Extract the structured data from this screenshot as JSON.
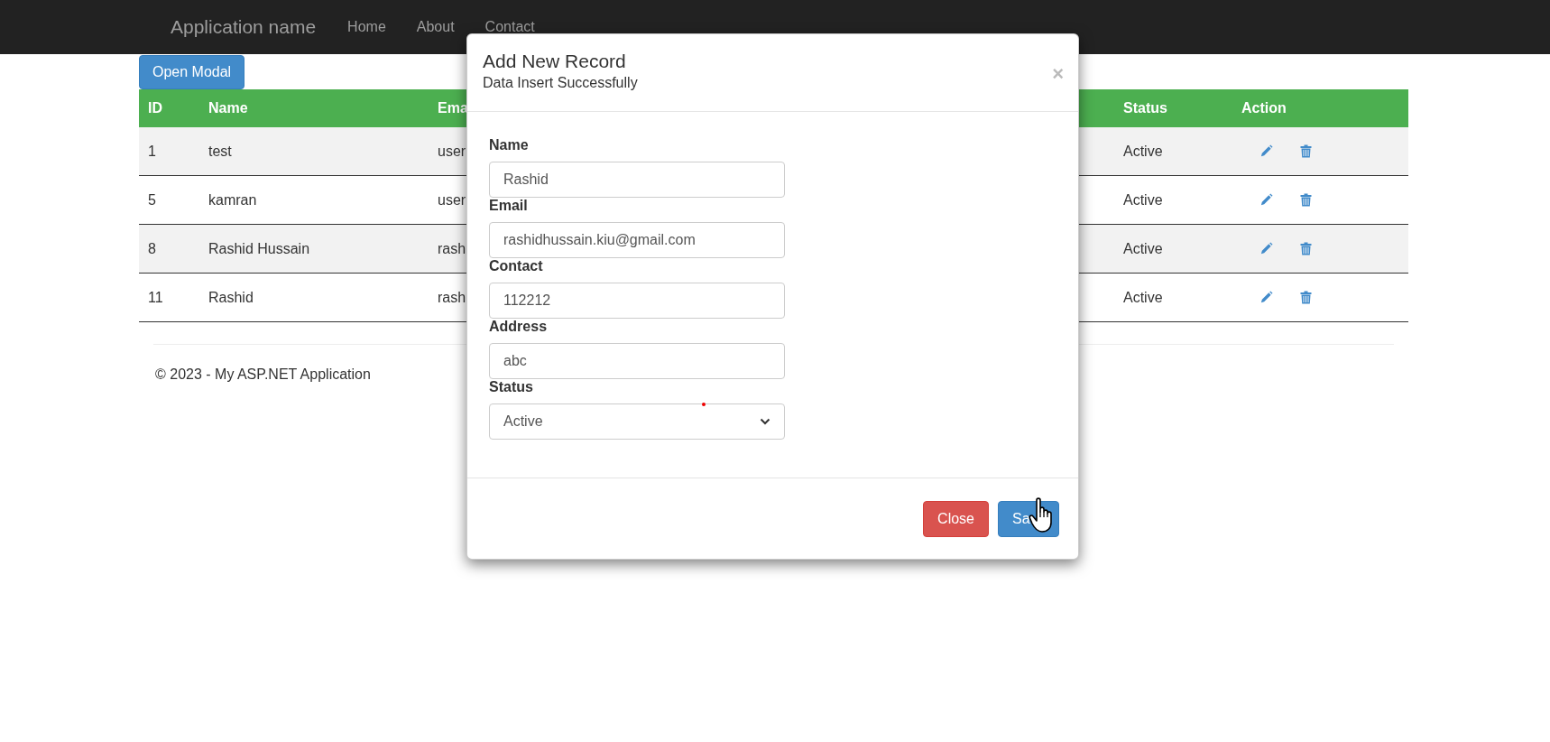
{
  "navbar": {
    "brand": "Application name",
    "links": [
      "Home",
      "About",
      "Contact"
    ]
  },
  "open_button": "Open Modal",
  "table": {
    "columns": [
      "ID",
      "Name",
      "Ema",
      "Status",
      "Action"
    ],
    "rows": [
      {
        "id": "1",
        "name": "test",
        "email": "user",
        "status": "Active"
      },
      {
        "id": "5",
        "name": "kamran",
        "email": "user",
        "status": "Active"
      },
      {
        "id": "8",
        "name": "Rashid Hussain",
        "email": "rash",
        "status": "Active"
      },
      {
        "id": "11",
        "name": "Rashid",
        "email": "rash",
        "status": "Active"
      }
    ]
  },
  "footer": "© 2023 - My ASP.NET Application",
  "modal": {
    "title": "Add New Record",
    "message": "Data Insert Successfully",
    "close_icon": "×",
    "fields": [
      {
        "label": "Name",
        "kind": "text",
        "value": "Rashid"
      },
      {
        "label": "Email",
        "kind": "text",
        "value": "rashidhussain.kiu@gmail.com"
      },
      {
        "label": "Contact",
        "kind": "text",
        "value": "112212"
      },
      {
        "label": "Address",
        "kind": "text",
        "value": "abc"
      },
      {
        "label": "Status",
        "kind": "select",
        "value": "Active"
      }
    ],
    "buttons": [
      {
        "label": "Close",
        "kind": "danger"
      },
      {
        "label": "Sa",
        "kind": "primary"
      }
    ]
  }
}
